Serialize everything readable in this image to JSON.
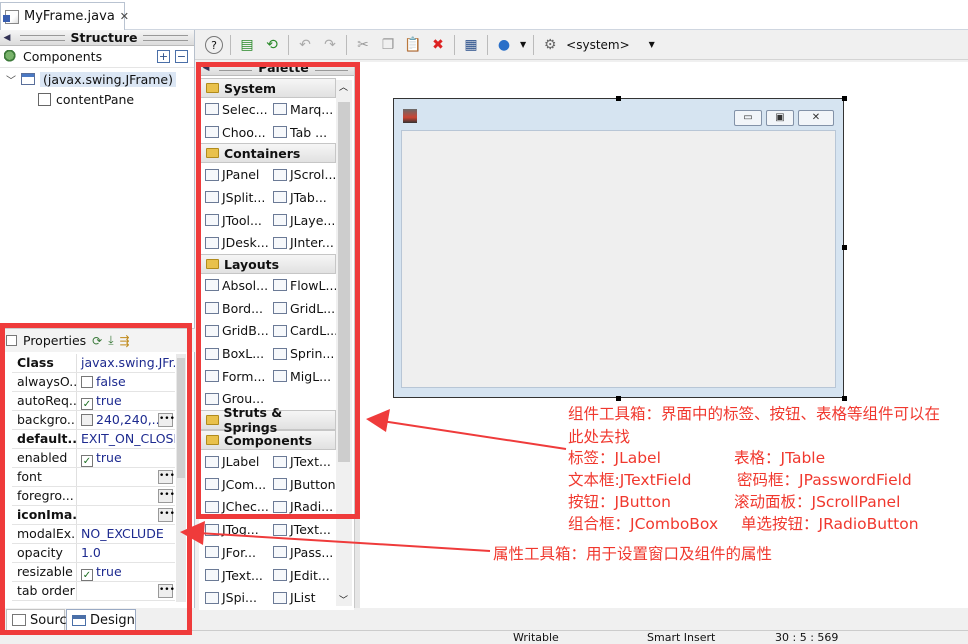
{
  "editor_tab": {
    "filename": "MyFrame.java",
    "close": "✕"
  },
  "structure": {
    "title": "Structure",
    "components_label": "Components",
    "tree": [
      {
        "label": "(javax.swing.JFrame)"
      },
      {
        "label": "contentPane"
      }
    ]
  },
  "properties": {
    "title": "Properties",
    "rows": [
      {
        "key": "Class",
        "value": "javax.swing.JFr...",
        "bold": true
      },
      {
        "key": "alwaysO...",
        "value": "false",
        "checkbox": false
      },
      {
        "key": "autoReq...",
        "value": "true",
        "checkbox": true
      },
      {
        "key": "backgro...",
        "value": "240,240,...",
        "swatch": true,
        "dots": true
      },
      {
        "key": "default...",
        "value": "EXIT_ON_CLOSE",
        "bold": true
      },
      {
        "key": "enabled",
        "value": "true",
        "checkbox": true
      },
      {
        "key": "font",
        "value": "",
        "dots": true
      },
      {
        "key": "foregro...",
        "value": "",
        "dots": true
      },
      {
        "key": "iconIma...",
        "value": "",
        "bold": true,
        "dots": true
      },
      {
        "key": "modalEx...",
        "value": "NO_EXCLUDE"
      },
      {
        "key": "opacity",
        "value": "1.0"
      },
      {
        "key": "resizable",
        "value": "true",
        "checkbox": true
      },
      {
        "key": "tab order",
        "value": "",
        "dots": true
      }
    ]
  },
  "bottom_tabs": {
    "source": "Source",
    "design": "Design"
  },
  "toolbar": {
    "system_label": "<system>"
  },
  "palette": {
    "title": "Palette",
    "groups": [
      {
        "name": "System",
        "items": [
          "Selec...",
          "Marq...",
          "Choo...",
          "Tab ..."
        ]
      },
      {
        "name": "Containers",
        "items": [
          "JPanel",
          "JScrol...",
          "JSplit...",
          "JTab...",
          "JTool...",
          "JLaye...",
          "JDesk...",
          "JInter..."
        ]
      },
      {
        "name": "Layouts",
        "items": [
          "Absol...",
          "FlowL...",
          "Bord...",
          "GridL...",
          "GridB...",
          "CardL...",
          "BoxL...",
          "Sprin...",
          "Form...",
          "MigL...",
          "Grou..."
        ]
      },
      {
        "name": "Struts & Springs",
        "items": []
      },
      {
        "name": "Components",
        "items": [
          "JLabel",
          "JText...",
          "JCom...",
          "JButton",
          "JChec...",
          "JRadi...",
          "JTog...",
          "JText...",
          "JFor...",
          "JPass...",
          "JText...",
          "JEdit...",
          "JSpi...",
          "JList"
        ]
      }
    ]
  },
  "annotations": {
    "palette_note": "组件工具箱：界面中的标签、按钮、表格等组件可以在",
    "palette_note2": "此处去找",
    "pairs": [
      [
        "标签：JLabel",
        "表格：JTable"
      ],
      [
        "文本框:JTextField",
        "密码框：JPasswordField"
      ],
      [
        "按钮：JButton",
        "滚动面板：JScrollPanel"
      ],
      [
        "组合框：JComboBox",
        "单选按钮：JRadioButton"
      ]
    ],
    "properties_note": "属性工具箱：用于设置窗口及组件的属性"
  },
  "statusbar": {
    "writable": "Writable",
    "insert": "Smart Insert",
    "position": "30 : 5 : 569"
  },
  "colors": {
    "annotation": "#ef3b3b"
  }
}
